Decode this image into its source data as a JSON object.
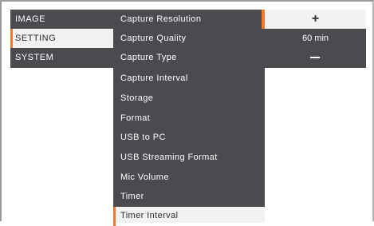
{
  "left_menu": {
    "items": [
      {
        "label": "IMAGE"
      },
      {
        "label": "SETTING"
      },
      {
        "label": "SYSTEM"
      }
    ]
  },
  "middle_menu": {
    "items": [
      {
        "label": "Capture Resolution"
      },
      {
        "label": "Capture Quality"
      },
      {
        "label": "Capture Type"
      },
      {
        "label": "Capture Interval"
      },
      {
        "label": "Storage"
      },
      {
        "label": "Format"
      },
      {
        "label": "USB to PC"
      },
      {
        "label": "USB Streaming Format"
      },
      {
        "label": "Mic Volume"
      },
      {
        "label": "Timer"
      },
      {
        "label": "Timer Interval"
      }
    ]
  },
  "value_panel": {
    "increase_symbol": "+",
    "value": "60 min",
    "decrease_symbol": "−"
  },
  "colors": {
    "menu_bg": "#4a4a4f",
    "selected_bg": "#f2f2f2",
    "accent": "#f07a2a"
  }
}
